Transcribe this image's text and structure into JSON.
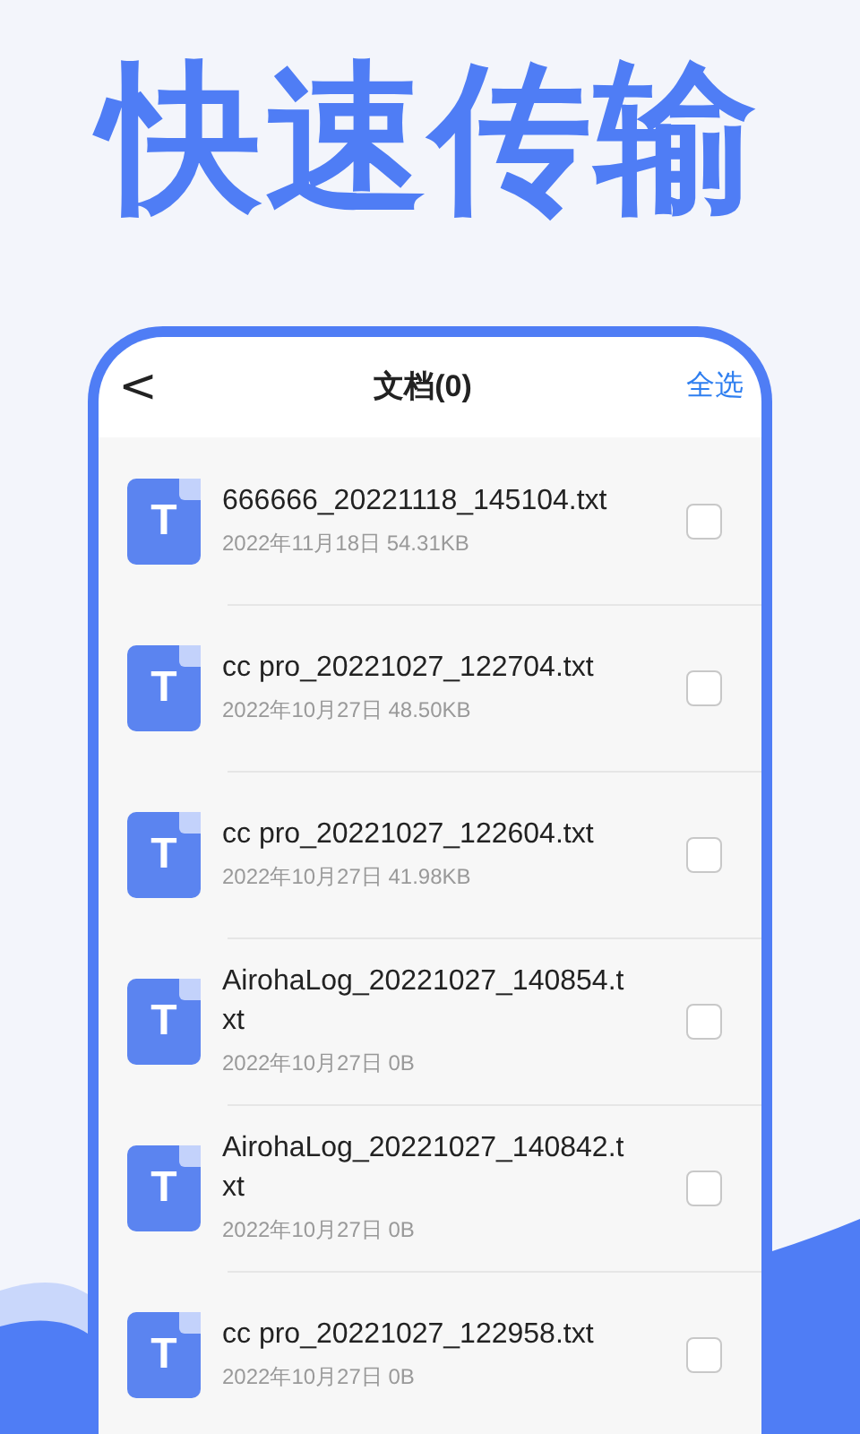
{
  "headline": "快速传输",
  "header": {
    "back": "<",
    "title": "文档(0)",
    "select_all": "全选"
  },
  "files": [
    {
      "icon_letter": "T",
      "name": "666666_20221118_145104.txt",
      "meta": "2022年11月18日 54.31KB",
      "checked": false
    },
    {
      "icon_letter": "T",
      "name": "cc pro_20221027_122704.txt",
      "meta": "2022年10月27日 48.50KB",
      "checked": false
    },
    {
      "icon_letter": "T",
      "name": "cc pro_20221027_122604.txt",
      "meta": "2022年10月27日 41.98KB",
      "checked": false
    },
    {
      "icon_letter": "T",
      "name": "AirohaLog_20221027_140854.txt",
      "meta": "2022年10月27日 0B",
      "checked": false
    },
    {
      "icon_letter": "T",
      "name": "AirohaLog_20221027_140842.txt",
      "meta": "2022年10月27日 0B",
      "checked": false
    },
    {
      "icon_letter": "T",
      "name": "cc pro_20221027_122958.txt",
      "meta": "2022年10月27日 0B",
      "checked": false
    }
  ]
}
